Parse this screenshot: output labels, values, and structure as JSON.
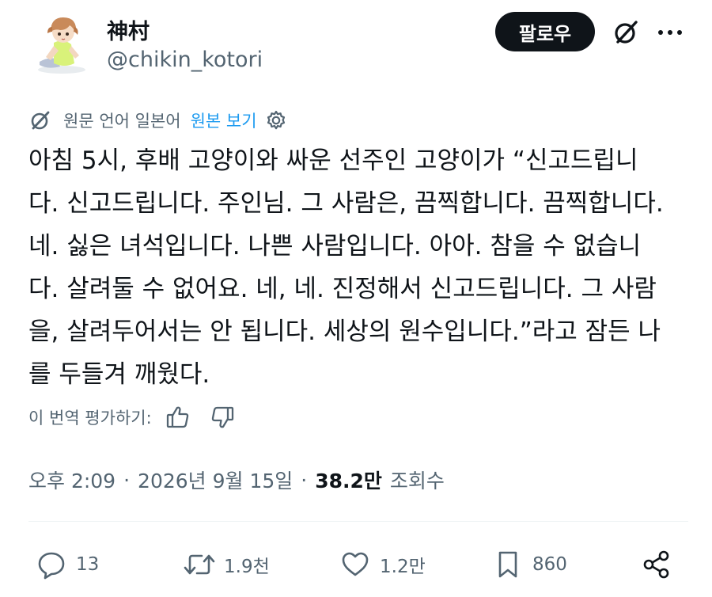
{
  "author": {
    "display_name": "神村",
    "handle": "@chikin_kotori",
    "avatar_icon": "avatar-illustration-icon"
  },
  "header": {
    "follow_label": "팔로우",
    "grok_icon": "grok-icon",
    "more_icon": "more-dots-icon"
  },
  "translation": {
    "info": "원문 언어 일본어",
    "view_original": "원본 보기",
    "settings_icon": "gear-icon",
    "lang_icon": "grok-icon"
  },
  "tweet": {
    "lines": [
      "아침 5시, 후배 고양이와 싸운 선주인 고양이가 “신고드립니",
      "다. 신고드립니다. 주인님. 그 사람은, 끔찍합니다. 끔찍합니다.",
      "네. 싫은 녀석입니다. 나쁜 사람입니다. 아아. 참을 수 없습니",
      "다. 살려둘 수 없어요. 네, 네. 진정해서 신고드립니다. 그 사람",
      "을, 살려두어서는 안 됩니다. 세상의 원수입니다.”라고 잠든 나",
      "를 두들겨 깨웠다."
    ]
  },
  "rating": {
    "label": "이 번역 평가하기:",
    "thumbs_up_icon": "thumbs-up-icon",
    "thumbs_down_icon": "thumbs-down-icon"
  },
  "meta": {
    "time": "오후 2:09",
    "separator": "·",
    "date": "2026년 9월 15일",
    "views_count": "38.2만",
    "views_label": "조회수"
  },
  "actions": {
    "replies": "13",
    "retweets": "1.9천",
    "likes": "1.2만",
    "bookmarks": "860",
    "icons": [
      "reply-icon",
      "retweet-icon",
      "like-icon",
      "bookmark-icon",
      "share-icon"
    ]
  },
  "colors": {
    "text": "#0f1419",
    "secondary": "#536471",
    "link": "#1d9bf0",
    "follow_bg": "#0f1419"
  }
}
